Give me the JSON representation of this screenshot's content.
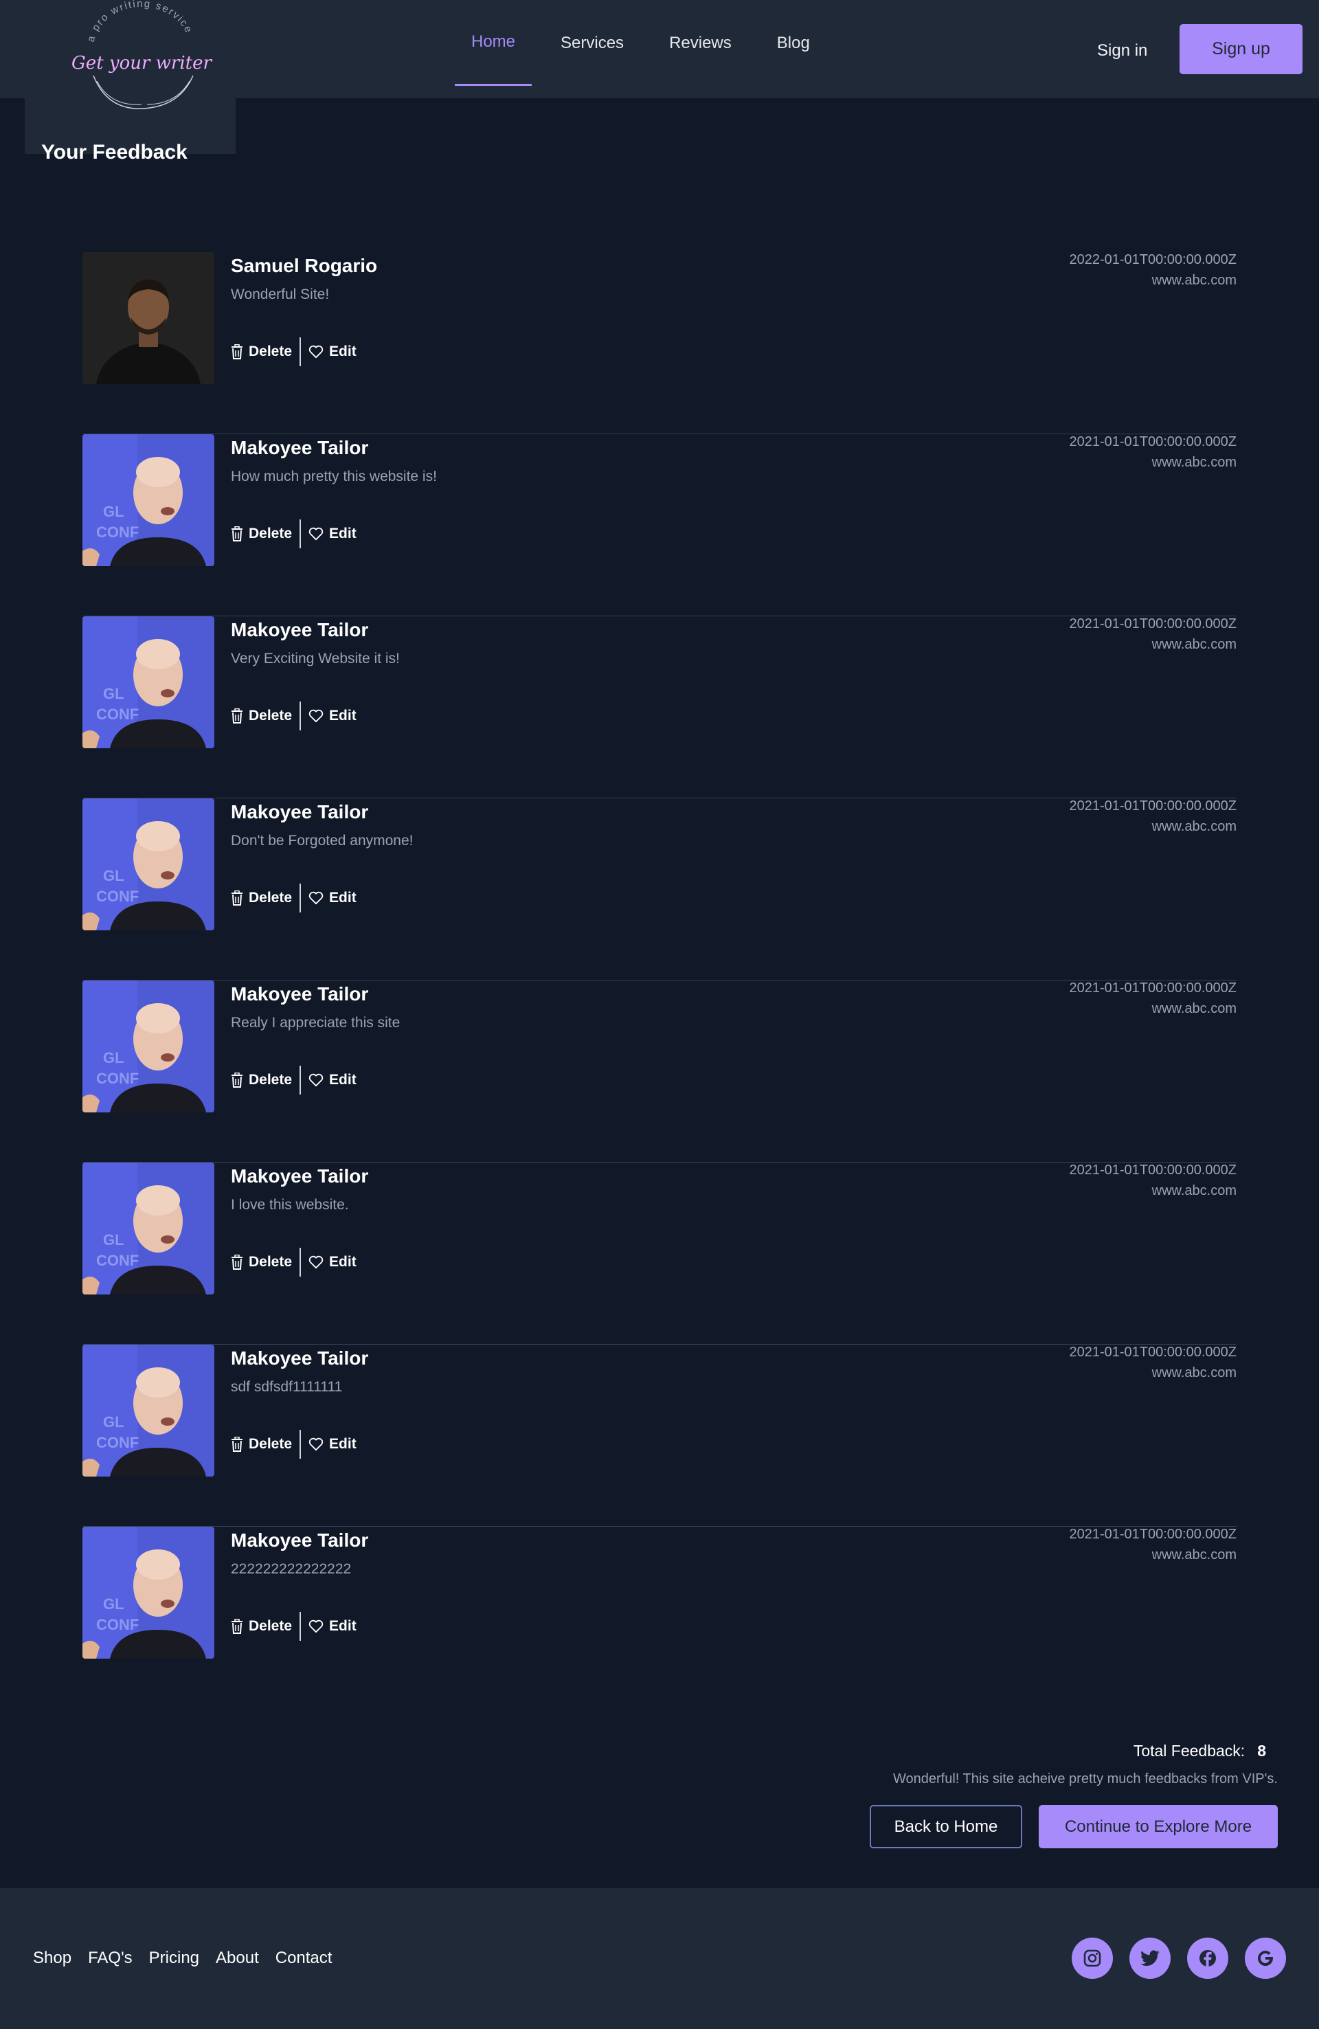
{
  "brand": {
    "logo_text": "Get your writer",
    "logo_tagline": "a pro writing service"
  },
  "nav": {
    "items": [
      {
        "label": "Home",
        "active": true
      },
      {
        "label": "Services",
        "active": false
      },
      {
        "label": "Reviews",
        "active": false
      },
      {
        "label": "Blog",
        "active": false
      }
    ],
    "signin_label": "Sign in",
    "signup_label": "Sign up"
  },
  "page": {
    "title": "Your Feedback"
  },
  "actions": {
    "delete_label": "Delete",
    "edit_label": "Edit"
  },
  "feedback": [
    {
      "name": "Samuel Rogario",
      "message": "Wonderful Site!",
      "date": "2022-01-01T00:00:00.000Z",
      "website": "www.abc.com",
      "avatar": "avatar-dark"
    },
    {
      "name": "Makoyee Tailor",
      "message": "How much pretty this website is!",
      "date": "2021-01-01T00:00:00.000Z",
      "website": "www.abc.com",
      "avatar": "avatar-blue"
    },
    {
      "name": "Makoyee Tailor",
      "message": "Very Exciting Website it is!",
      "date": "2021-01-01T00:00:00.000Z",
      "website": "www.abc.com",
      "avatar": "avatar-blue"
    },
    {
      "name": "Makoyee Tailor",
      "message": "Don't be Forgoted anymone!",
      "date": "2021-01-01T00:00:00.000Z",
      "website": "www.abc.com",
      "avatar": "avatar-blue"
    },
    {
      "name": "Makoyee Tailor",
      "message": "Realy I appreciate this site",
      "date": "2021-01-01T00:00:00.000Z",
      "website": "www.abc.com",
      "avatar": "avatar-blue"
    },
    {
      "name": "Makoyee Tailor",
      "message": "I love this website.",
      "date": "2021-01-01T00:00:00.000Z",
      "website": "www.abc.com",
      "avatar": "avatar-blue"
    },
    {
      "name": "Makoyee Tailor",
      "message": "sdf sdfsdf1111111",
      "date": "2021-01-01T00:00:00.000Z",
      "website": "www.abc.com",
      "avatar": "avatar-blue"
    },
    {
      "name": "Makoyee Tailor",
      "message": "222222222222222",
      "date": "2021-01-01T00:00:00.000Z",
      "website": "www.abc.com",
      "avatar": "avatar-blue"
    }
  ],
  "summary": {
    "total_label": "Total Feedback:",
    "total_count": "8",
    "text": "Wonderful! This site acheive pretty much feedbacks from VIP's.",
    "back_label": "Back to Home",
    "explore_label": "Continue to Explore More"
  },
  "footer": {
    "links": [
      "Shop",
      "FAQ's",
      "Pricing",
      "About",
      "Contact"
    ],
    "socials": [
      "instagram-icon",
      "twitter-icon",
      "facebook-icon",
      "google-icon"
    ]
  },
  "colors": {
    "accent": "#a78bfa",
    "background": "#111827",
    "header": "#1f2937"
  }
}
